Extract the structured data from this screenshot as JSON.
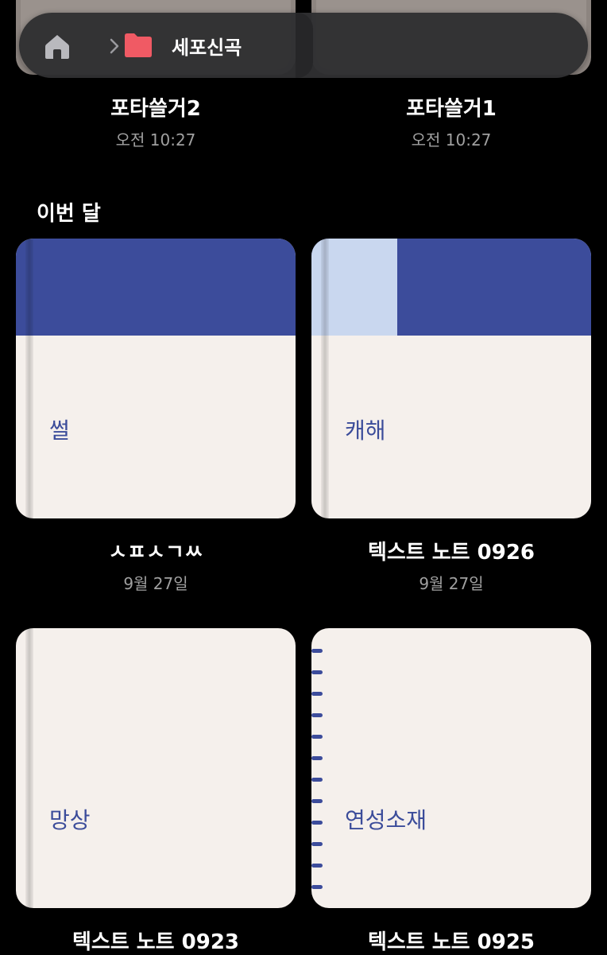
{
  "colors": {
    "accent_blue": "#3c4c9b",
    "light_blue": "#c9d7ef",
    "paper": "#f5f0ec",
    "folder_red": "#f05a64"
  },
  "breadcrumb": {
    "home_icon": "home-icon",
    "chevron_icon": "chevron-right-icon",
    "folder_icon": "folder-icon",
    "label": "세포신곡"
  },
  "recent": [
    {
      "title": "포타쓸거2",
      "date": "오전 10:27"
    },
    {
      "title": "포타쓸거1",
      "date": "오전 10:27"
    }
  ],
  "section_label": "이번 달",
  "notes": [
    {
      "cover_text": "썰",
      "title": "ㅅㅍㅅㄱㅆ",
      "date": "9월 27일"
    },
    {
      "cover_text": "캐해",
      "title": "텍스트 노트 0926",
      "date": "9월 27일"
    },
    {
      "cover_text": "망상",
      "title": "텍스트 노트 0923"
    },
    {
      "cover_text": "연성소재",
      "title": "텍스트 노트 0925"
    }
  ]
}
